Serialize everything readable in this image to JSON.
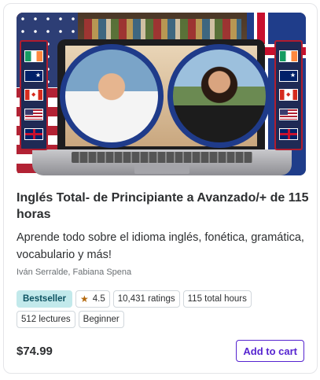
{
  "course": {
    "thumbnail_alt": "",
    "title": "Inglés Total- de Principiante a Avanzado/+ de 115 horas",
    "subtitle": "Aprende todo sobre el idioma inglés, fonética, gramática, vocabulario y más!",
    "instructors": "Iván Serralde, Fabiana Spena",
    "badge": "Bestseller",
    "rating": "4.5",
    "ratings_count": "10,431 ratings",
    "total_hours": "115 total hours",
    "lectures": "512 lectures",
    "level": "Beginner",
    "price": "$74.99",
    "add_to_cart_label": "Add to cart"
  },
  "icons": {
    "rating": "star-icon"
  },
  "colors": {
    "accent": "#5624d0",
    "bestseller_bg": "#c2e9eb",
    "bestseller_text": "#0d5261",
    "star": "#b4690e"
  }
}
